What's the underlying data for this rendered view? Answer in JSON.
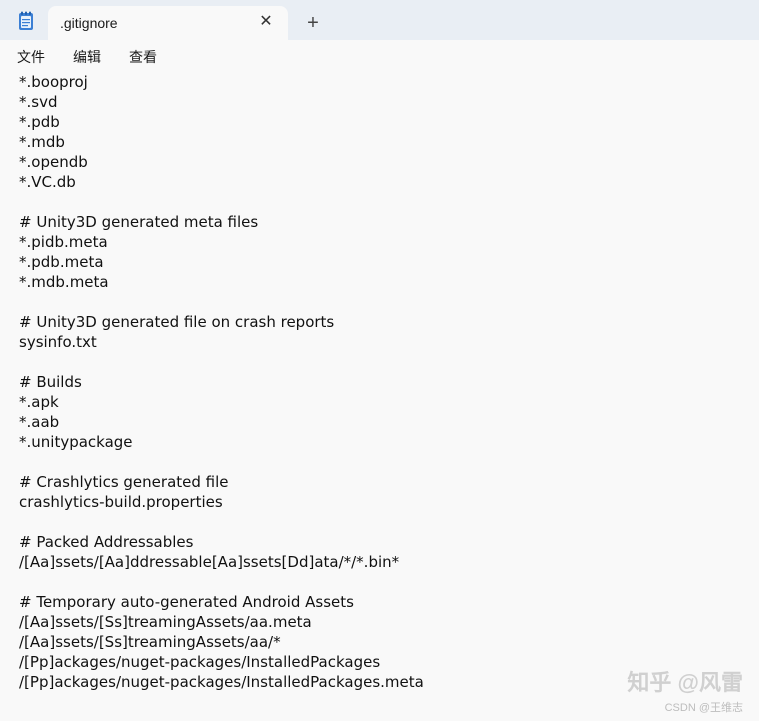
{
  "tab": {
    "title": ".gitignore",
    "close_glyph": "✕",
    "add_glyph": "+"
  },
  "menu": {
    "file": "文件",
    "edit": "编辑",
    "view": "查看"
  },
  "editor": {
    "lines": [
      "*.booproj",
      "*.svd",
      "*.pdb",
      "*.mdb",
      "*.opendb",
      "*.VC.db",
      "",
      "# Unity3D generated meta files",
      "*.pidb.meta",
      "*.pdb.meta",
      "*.mdb.meta",
      "",
      "# Unity3D generated file on crash reports",
      "sysinfo.txt",
      "",
      "# Builds",
      "*.apk",
      "*.aab",
      "*.unitypackage",
      "",
      "# Crashlytics generated file",
      "crashlytics-build.properties",
      "",
      "# Packed Addressables",
      "/[Aa]ssets/[Aa]ddressable[Aa]ssets[Dd]ata/*/*.bin*",
      "",
      "# Temporary auto-generated Android Assets",
      "/[Aa]ssets/[Ss]treamingAssets/aa.meta",
      "/[Aa]ssets/[Ss]treamingAssets/aa/*",
      "/[Pp]ackages/nuget-packages/InstalledPackages",
      "/[Pp]ackages/nuget-packages/InstalledPackages.meta"
    ]
  },
  "watermark": {
    "line1": "知乎 @风雷",
    "line2": "CSDN @王维志"
  },
  "icons": {
    "app": "notepad-icon"
  },
  "colors": {
    "tabbar_bg": "#e9eef4",
    "window_bg": "#f9f9f9",
    "text": "#111111"
  }
}
